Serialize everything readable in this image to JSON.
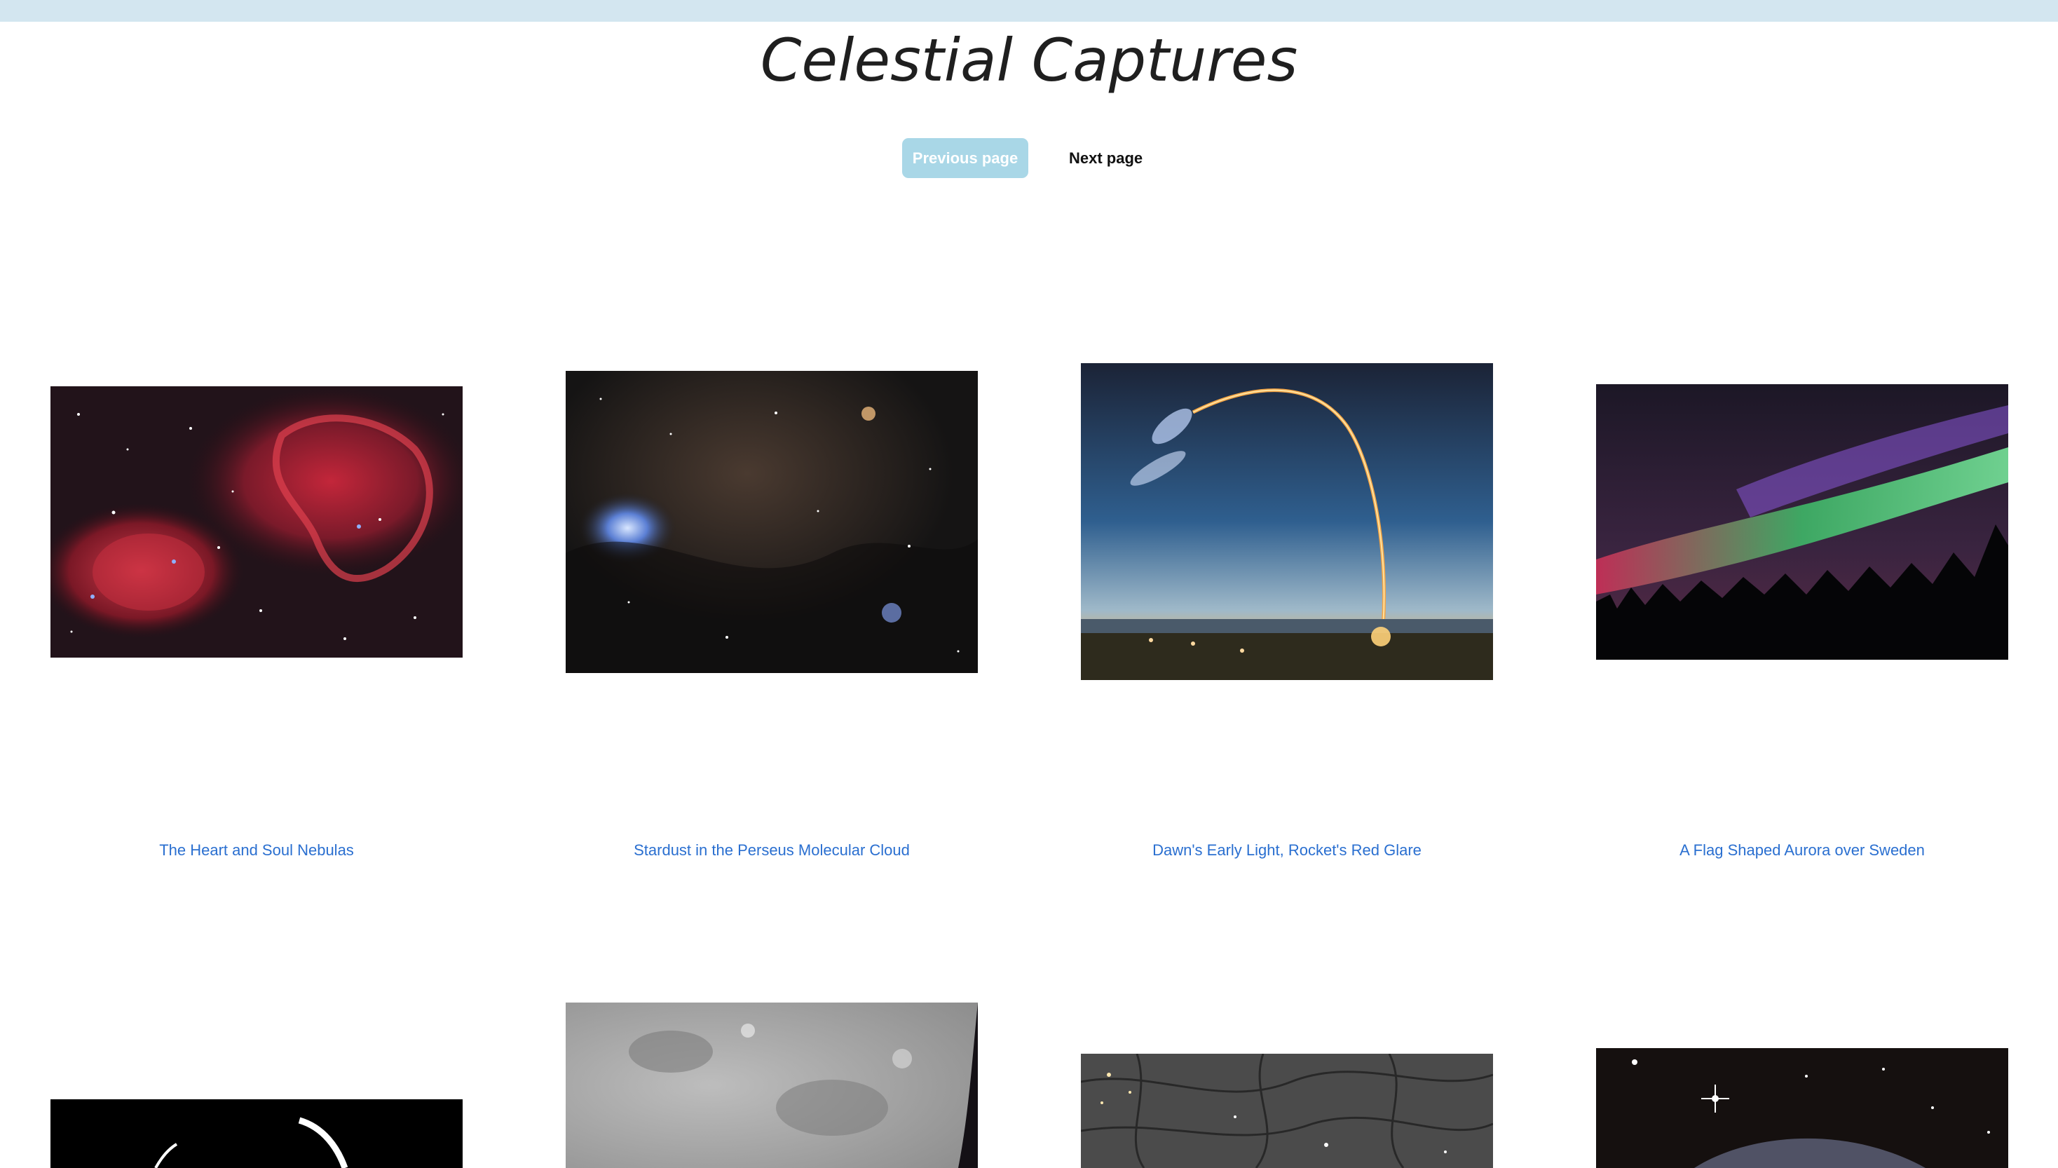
{
  "site": {
    "title": "Celestial Captures"
  },
  "pagination": {
    "previous_label": "Previous page",
    "next_label": "Next page"
  },
  "gallery": {
    "items": [
      {
        "title": "The Heart and Soul Nebulas",
        "image": "heart-and-soul-nebula-image"
      },
      {
        "title": "Stardust in the Perseus Molecular Cloud",
        "image": "perseus-molecular-cloud-image"
      },
      {
        "title": "Dawn's Early Light, Rocket's Red Glare",
        "image": "rocket-launch-image"
      },
      {
        "title": "A Flag Shaped Aurora over Sweden",
        "image": "aurora-sweden-image"
      },
      {
        "title": "",
        "image": "curved-star-trails-image"
      },
      {
        "title": "",
        "image": "moon-surface-image"
      },
      {
        "title": "",
        "image": "dark-web-structure-image"
      },
      {
        "title": "",
        "image": "galaxy-with-stars-image"
      }
    ]
  },
  "colors": {
    "top_bar": "#d3e6f0",
    "link": "#2a6fd0",
    "previous_button_bg": "#a9d7e7"
  }
}
